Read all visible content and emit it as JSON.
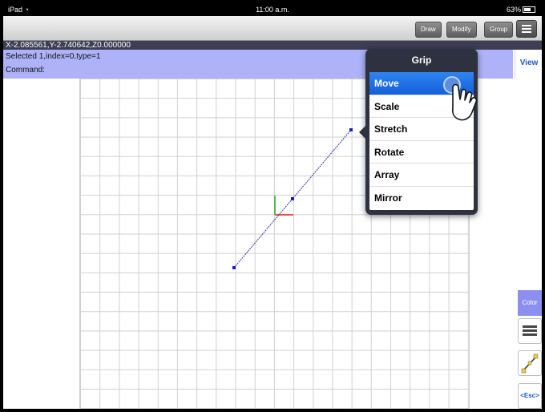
{
  "status_bar": {
    "device": "iPad",
    "time": "11:00 a.m.",
    "battery": "63%"
  },
  "toolbar": {
    "draw": "Draw",
    "modify": "Modify",
    "group": "Group"
  },
  "command_area": {
    "coords": "X-2.085561,Y-2.740642,Z0.000000",
    "selection": "Selected 1,index=0,type=1",
    "command": "Command:"
  },
  "view_button": "View",
  "grip_menu": {
    "title": "Grip",
    "items": [
      "Move",
      "Scale",
      "Stretch",
      "Rotate",
      "Array",
      "Mirror"
    ],
    "selected": "Move"
  },
  "side_tools": {
    "color": "Color",
    "esc": "<Esc>"
  },
  "colors": {
    "command_bg": "#aeb2f8",
    "selected_item": "#1f6fe5",
    "line": "#2e2ea8",
    "axis_x": "#e11d1d",
    "axis_y": "#19b319"
  },
  "icons": [
    "wifi-icon",
    "battery-icon",
    "menu-icon",
    "hand-cursor-icon",
    "layers-icon",
    "line-tool-icon"
  ]
}
